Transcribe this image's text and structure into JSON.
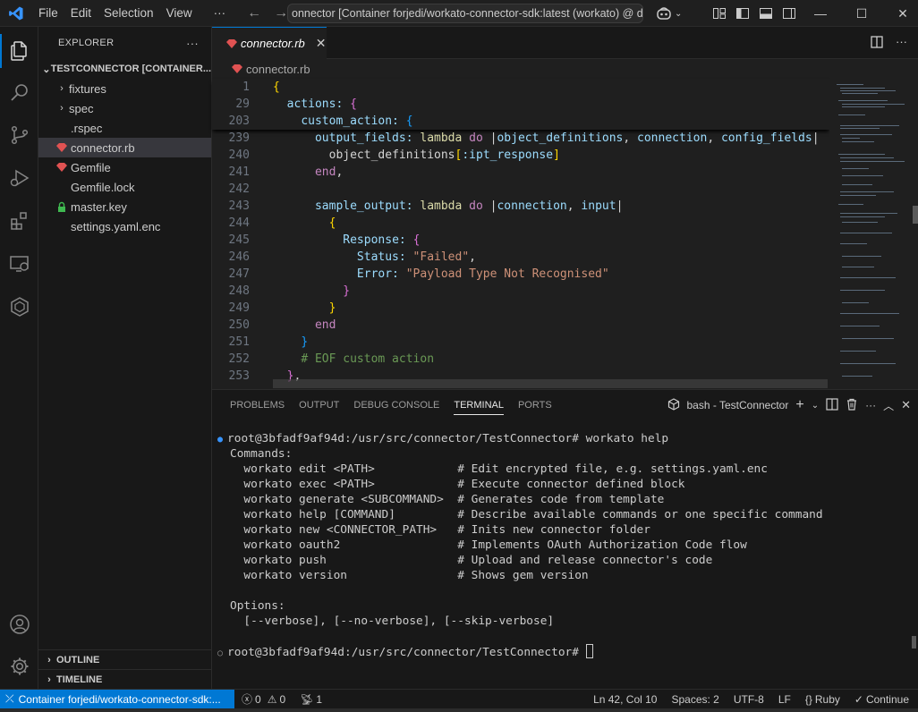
{
  "menu": [
    "File",
    "Edit",
    "Selection",
    "View",
    "···"
  ],
  "command_center": "onnector [Container forjedi/workato-connector-sdk:latest (workato) @ desk",
  "explorer": {
    "title": "EXPLORER",
    "more": "···",
    "root": "TESTCONNECTOR [CONTAINER...",
    "items": [
      {
        "label": "fixtures",
        "type": "folder"
      },
      {
        "label": "spec",
        "type": "folder"
      },
      {
        "label": ".rspec",
        "type": "file"
      },
      {
        "label": "connector.rb",
        "type": "ruby"
      },
      {
        "label": "Gemfile",
        "type": "ruby"
      },
      {
        "label": "Gemfile.lock",
        "type": "file"
      },
      {
        "label": "master.key",
        "type": "lock"
      },
      {
        "label": "settings.yaml.enc",
        "type": "file"
      }
    ],
    "outline": "OUTLINE",
    "timeline": "TIMELINE"
  },
  "editor": {
    "tab_label": "connector.rb",
    "breadcrumb": "connector.rb",
    "line_numbers": [
      "1",
      "29",
      "203",
      "239",
      "240",
      "241",
      "242",
      "243",
      "244",
      "245",
      "246",
      "247",
      "248",
      "249",
      "250",
      "251",
      "252",
      "253"
    ]
  },
  "panel": {
    "tabs": [
      "PROBLEMS",
      "OUTPUT",
      "DEBUG CONSOLE",
      "TERMINAL",
      "PORTS"
    ],
    "terminal_name": "bash - TestConnector",
    "terminal": [
      "root@3bfadf9af94d:/usr/src/connector/TestConnector# workato help",
      "Commands:",
      "  workato edit <PATH>            # Edit encrypted file, e.g. settings.yaml.enc",
      "  workato exec <PATH>            # Execute connector defined block",
      "  workato generate <SUBCOMMAND>  # Generates code from template",
      "  workato help [COMMAND]         # Describe available commands or one specific command",
      "  workato new <CONNECTOR_PATH>   # Inits new connector folder",
      "  workato oauth2                 # Implements OAuth Authorization Code flow",
      "  workato push                   # Upload and release connector's code",
      "  workato version                # Shows gem version",
      "",
      "Options:",
      "  [--verbose], [--no-verbose], [--skip-verbose]",
      "",
      "root@3bfadf9af94d:/usr/src/connector/TestConnector# "
    ]
  },
  "status": {
    "remote": "Container forjedi/workato-connector-sdk:...",
    "errors": "0",
    "warnings": "0",
    "ports": "1",
    "position": "Ln 42, Col 10",
    "spaces": "Spaces: 2",
    "encoding": "UTF-8",
    "eol": "LF",
    "language": "Ruby",
    "continue": "Continue"
  },
  "colors": {
    "accent": "#0078d4",
    "ruby": "#e05252"
  }
}
